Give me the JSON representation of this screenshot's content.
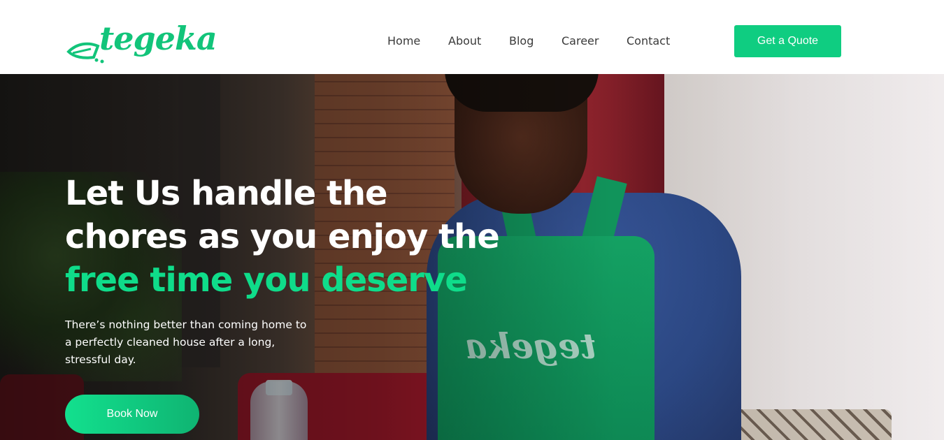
{
  "header": {
    "logo_text": "tegeka",
    "nav": [
      "Home",
      "About",
      "Blog",
      "Career",
      "Contact"
    ],
    "cta_label": "Get a Quote"
  },
  "hero": {
    "headline_line1": "Let Us handle the",
    "headline_line2": "chores as you enjoy the",
    "headline_accent": "free time you deserve",
    "subtext": "There’s nothing better than coming home to a perfectly cleaned house after a long, stressful day.",
    "book_label": "Book Now",
    "apron_text": "tegeka"
  },
  "colors": {
    "brand_green": "#0fcd81",
    "accent_green": "#0fdc8a"
  },
  "icons": {
    "logo": "broom-logo-icon"
  }
}
